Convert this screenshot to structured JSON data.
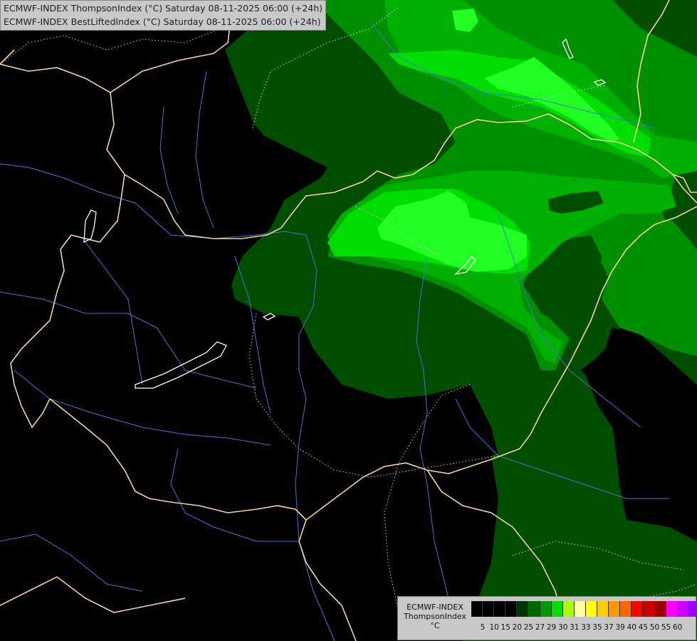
{
  "header": {
    "line1": "ECMWF-INDEX ThompsonIndex (°C) Saturday 08-11-2025 06:00 (+24h)",
    "line2": "ECMWF-INDEX BestLiftedIndex (°C) Saturday 08-11-2025 06:00 (+24h)"
  },
  "legend": {
    "model": "ECMWF-INDEX",
    "parameter": "ThompsonIndex",
    "unit": "°C",
    "ticks": [
      "5",
      "10",
      "15",
      "20",
      "25",
      "27",
      "29",
      "30",
      "31",
      "33",
      "35",
      "37",
      "39",
      "40",
      "45",
      "50",
      "55",
      "60"
    ],
    "colors": [
      "#000000",
      "#000000",
      "#000000",
      "#000000",
      "#003300",
      "#006600",
      "#009900",
      "#00dd00",
      "#aaff00",
      "#ffff99",
      "#ffff00",
      "#ffcc00",
      "#ff9900",
      "#ff6600",
      "#ff0000",
      "#cc0000",
      "#990000",
      "#ff00ff",
      "#cc00ff",
      "#9900ff",
      "#6600ff",
      "#0000ff"
    ]
  },
  "map_colors": {
    "background": "#000000",
    "dark_green": "#004d00",
    "mid_green": "#008f00",
    "green": "#00b000",
    "bright_green": "#00dd00",
    "lime": "#22ff22",
    "borders": "#f5d3a0",
    "rivers": "#4f6fd6",
    "lakes": "#ffffff"
  }
}
